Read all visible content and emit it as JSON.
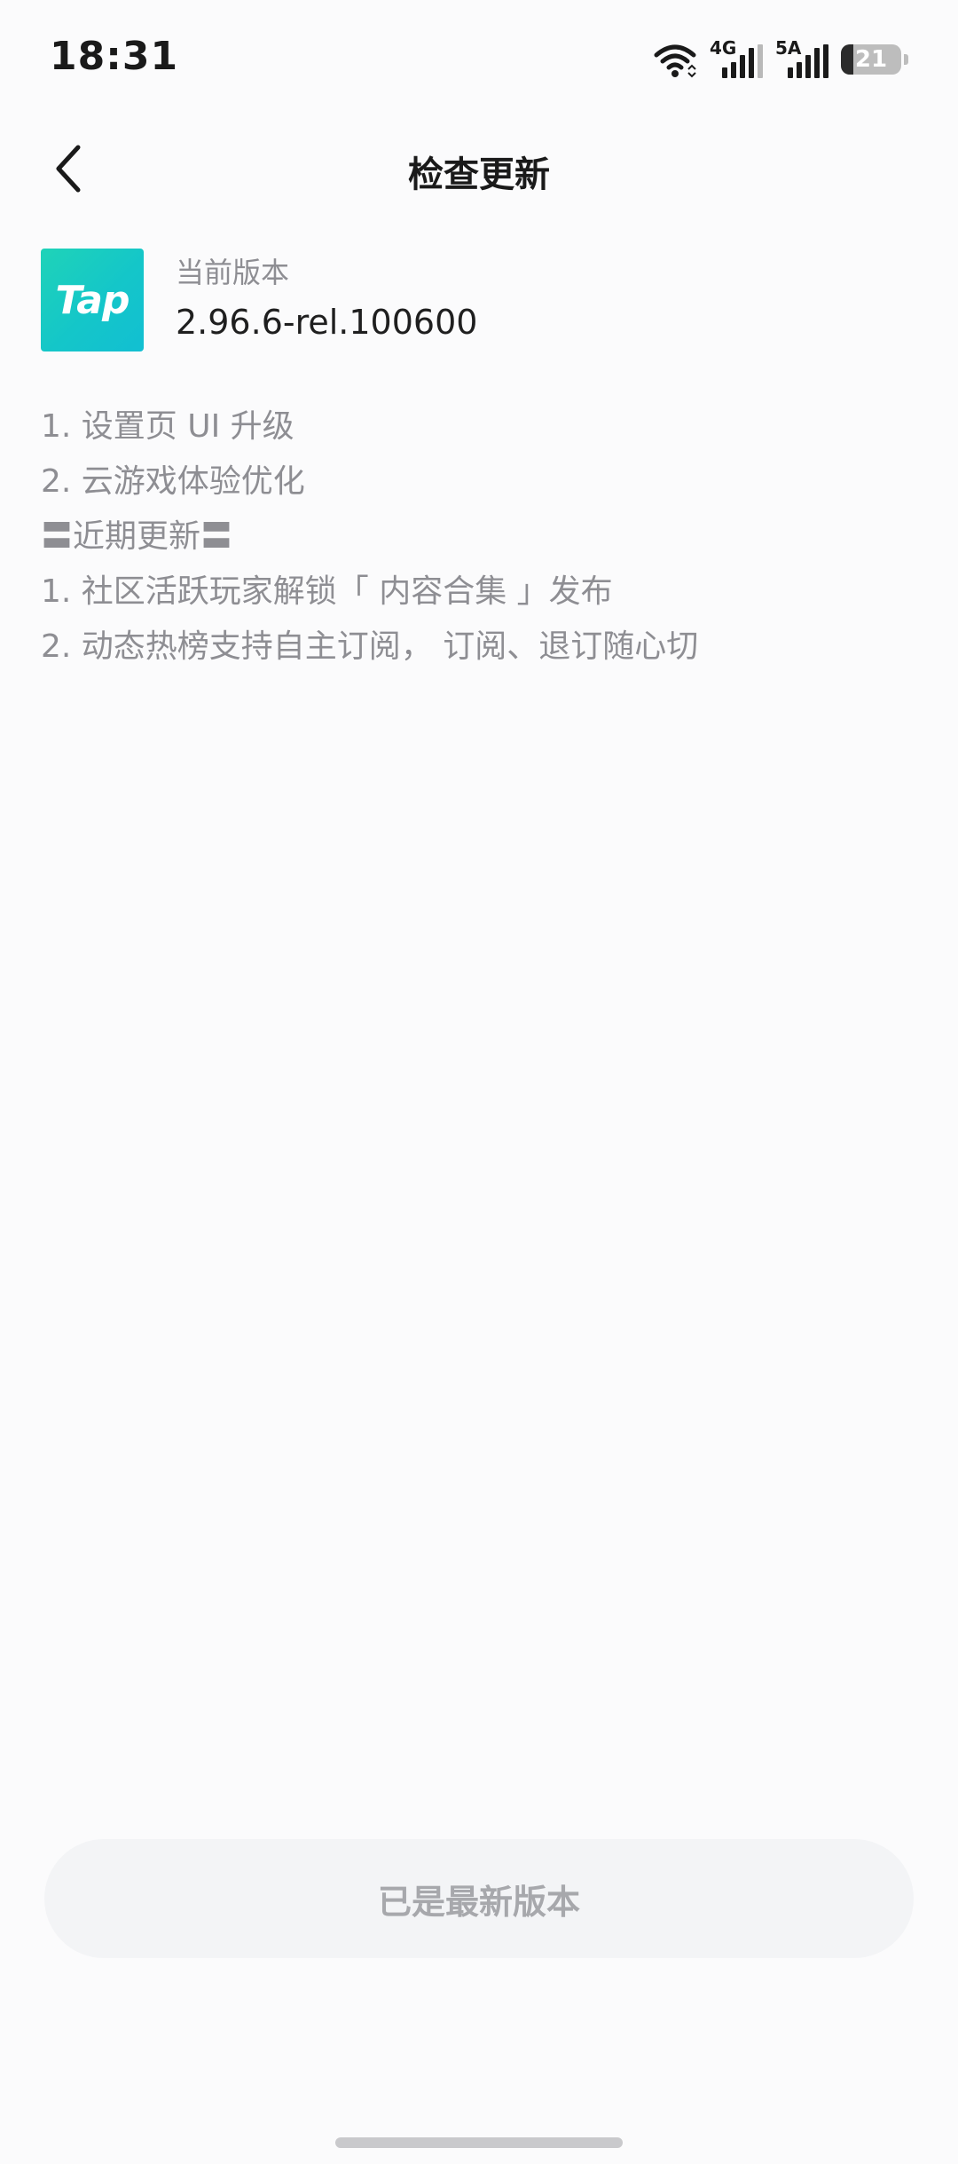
{
  "status_bar": {
    "time": "18:31",
    "network_1": "4G",
    "network_2": "5A",
    "battery_level": "21",
    "battery_fraction": 0.21,
    "icons": [
      "wifi-icon",
      "signal-4g-icon",
      "signal-5a-icon",
      "battery-icon"
    ]
  },
  "header": {
    "back_icon": "chevron-left-icon",
    "title": "检查更新"
  },
  "app_info": {
    "logo_text": "Tap",
    "version_label": "当前版本",
    "version_value": "2.96.6-rel.100600"
  },
  "changelog": [
    "1. 设置页 UI 升级",
    "2. 云游戏体验优化",
    "〓近期更新〓",
    "1. 社区活跃玩家解锁「 内容合集 」发布",
    "2. 动态热榜支持自主订阅， 订阅、退订随心切"
  ],
  "footer": {
    "button_label": "已是最新版本"
  },
  "colors": {
    "background": "#fbfbfc",
    "logo_gradient_start": "#1fd3b8",
    "logo_gradient_end": "#12bfd2",
    "muted_text": "#8e8e93",
    "button_bg": "#f3f4f6",
    "button_text": "#a7a8ac"
  }
}
